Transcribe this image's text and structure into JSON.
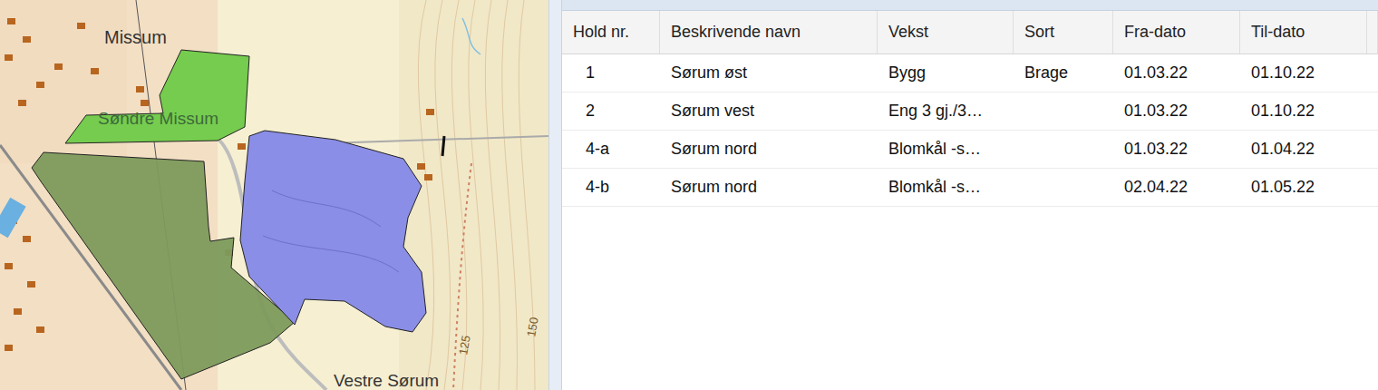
{
  "map": {
    "labels": [
      "Missum",
      "Søndre Missum",
      "Vestre Sørum",
      "125",
      "150"
    ],
    "fields": [
      {
        "name": "Sørum nord",
        "color": "#76cc4e"
      },
      {
        "name": "Sørum vest",
        "color": "#7d9a5c"
      },
      {
        "name": "Sørum øst",
        "color": "#8b8ee6"
      }
    ]
  },
  "table": {
    "columns": [
      "Hold nr.",
      "Beskrivende navn",
      "Vekst",
      "Sort",
      "Fra-dato",
      "Til-dato"
    ],
    "rows": [
      {
        "cells": [
          "1",
          "Sørum øst",
          "Bygg",
          "Brage",
          "01.03.22",
          "01.10.22"
        ],
        "selected": false
      },
      {
        "cells": [
          "2",
          "Sørum vest",
          "Eng 3 gj./3…",
          "",
          "01.03.22",
          "01.10.22"
        ],
        "selected": false
      },
      {
        "cells": [
          "4-a",
          "Sørum nord",
          "Blomkål -s…",
          "",
          "01.03.22",
          "01.04.22"
        ],
        "selected": false
      },
      {
        "cells": [
          "4-b",
          "Sørum nord",
          "Blomkål -s…",
          "",
          "02.04.22",
          "01.05.22"
        ],
        "selected": false
      }
    ]
  }
}
